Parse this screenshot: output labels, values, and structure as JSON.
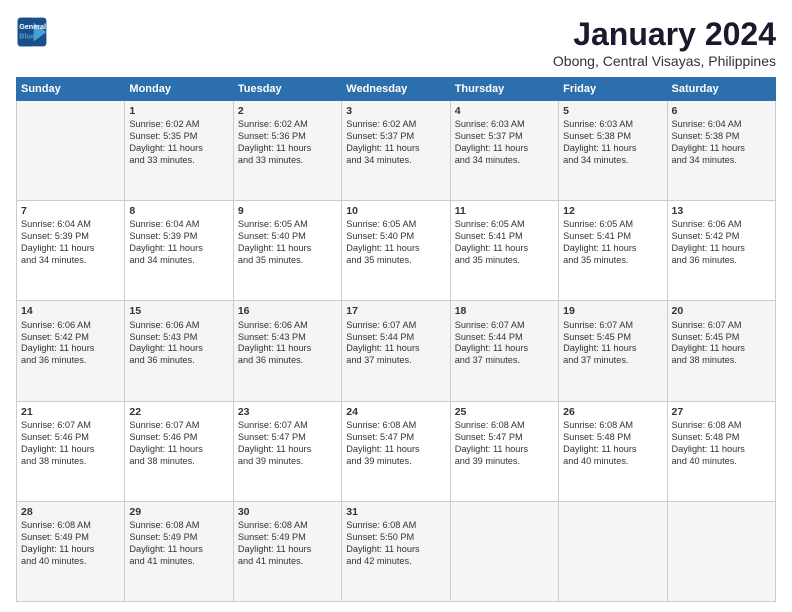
{
  "header": {
    "logo_line1": "General",
    "logo_line2": "Blue",
    "title": "January 2024",
    "subtitle": "Obong, Central Visayas, Philippines"
  },
  "days_of_week": [
    "Sunday",
    "Monday",
    "Tuesday",
    "Wednesday",
    "Thursday",
    "Friday",
    "Saturday"
  ],
  "weeks": [
    [
      {
        "day": "",
        "content": ""
      },
      {
        "day": "1",
        "content": "Sunrise: 6:02 AM\nSunset: 5:35 PM\nDaylight: 11 hours\nand 33 minutes."
      },
      {
        "day": "2",
        "content": "Sunrise: 6:02 AM\nSunset: 5:36 PM\nDaylight: 11 hours\nand 33 minutes."
      },
      {
        "day": "3",
        "content": "Sunrise: 6:02 AM\nSunset: 5:37 PM\nDaylight: 11 hours\nand 34 minutes."
      },
      {
        "day": "4",
        "content": "Sunrise: 6:03 AM\nSunset: 5:37 PM\nDaylight: 11 hours\nand 34 minutes."
      },
      {
        "day": "5",
        "content": "Sunrise: 6:03 AM\nSunset: 5:38 PM\nDaylight: 11 hours\nand 34 minutes."
      },
      {
        "day": "6",
        "content": "Sunrise: 6:04 AM\nSunset: 5:38 PM\nDaylight: 11 hours\nand 34 minutes."
      }
    ],
    [
      {
        "day": "7",
        "content": "Sunrise: 6:04 AM\nSunset: 5:39 PM\nDaylight: 11 hours\nand 34 minutes."
      },
      {
        "day": "8",
        "content": "Sunrise: 6:04 AM\nSunset: 5:39 PM\nDaylight: 11 hours\nand 34 minutes."
      },
      {
        "day": "9",
        "content": "Sunrise: 6:05 AM\nSunset: 5:40 PM\nDaylight: 11 hours\nand 35 minutes."
      },
      {
        "day": "10",
        "content": "Sunrise: 6:05 AM\nSunset: 5:40 PM\nDaylight: 11 hours\nand 35 minutes."
      },
      {
        "day": "11",
        "content": "Sunrise: 6:05 AM\nSunset: 5:41 PM\nDaylight: 11 hours\nand 35 minutes."
      },
      {
        "day": "12",
        "content": "Sunrise: 6:05 AM\nSunset: 5:41 PM\nDaylight: 11 hours\nand 35 minutes."
      },
      {
        "day": "13",
        "content": "Sunrise: 6:06 AM\nSunset: 5:42 PM\nDaylight: 11 hours\nand 36 minutes."
      }
    ],
    [
      {
        "day": "14",
        "content": "Sunrise: 6:06 AM\nSunset: 5:42 PM\nDaylight: 11 hours\nand 36 minutes."
      },
      {
        "day": "15",
        "content": "Sunrise: 6:06 AM\nSunset: 5:43 PM\nDaylight: 11 hours\nand 36 minutes."
      },
      {
        "day": "16",
        "content": "Sunrise: 6:06 AM\nSunset: 5:43 PM\nDaylight: 11 hours\nand 36 minutes."
      },
      {
        "day": "17",
        "content": "Sunrise: 6:07 AM\nSunset: 5:44 PM\nDaylight: 11 hours\nand 37 minutes."
      },
      {
        "day": "18",
        "content": "Sunrise: 6:07 AM\nSunset: 5:44 PM\nDaylight: 11 hours\nand 37 minutes."
      },
      {
        "day": "19",
        "content": "Sunrise: 6:07 AM\nSunset: 5:45 PM\nDaylight: 11 hours\nand 37 minutes."
      },
      {
        "day": "20",
        "content": "Sunrise: 6:07 AM\nSunset: 5:45 PM\nDaylight: 11 hours\nand 38 minutes."
      }
    ],
    [
      {
        "day": "21",
        "content": "Sunrise: 6:07 AM\nSunset: 5:46 PM\nDaylight: 11 hours\nand 38 minutes."
      },
      {
        "day": "22",
        "content": "Sunrise: 6:07 AM\nSunset: 5:46 PM\nDaylight: 11 hours\nand 38 minutes."
      },
      {
        "day": "23",
        "content": "Sunrise: 6:07 AM\nSunset: 5:47 PM\nDaylight: 11 hours\nand 39 minutes."
      },
      {
        "day": "24",
        "content": "Sunrise: 6:08 AM\nSunset: 5:47 PM\nDaylight: 11 hours\nand 39 minutes."
      },
      {
        "day": "25",
        "content": "Sunrise: 6:08 AM\nSunset: 5:47 PM\nDaylight: 11 hours\nand 39 minutes."
      },
      {
        "day": "26",
        "content": "Sunrise: 6:08 AM\nSunset: 5:48 PM\nDaylight: 11 hours\nand 40 minutes."
      },
      {
        "day": "27",
        "content": "Sunrise: 6:08 AM\nSunset: 5:48 PM\nDaylight: 11 hours\nand 40 minutes."
      }
    ],
    [
      {
        "day": "28",
        "content": "Sunrise: 6:08 AM\nSunset: 5:49 PM\nDaylight: 11 hours\nand 40 minutes."
      },
      {
        "day": "29",
        "content": "Sunrise: 6:08 AM\nSunset: 5:49 PM\nDaylight: 11 hours\nand 41 minutes."
      },
      {
        "day": "30",
        "content": "Sunrise: 6:08 AM\nSunset: 5:49 PM\nDaylight: 11 hours\nand 41 minutes."
      },
      {
        "day": "31",
        "content": "Sunrise: 6:08 AM\nSunset: 5:50 PM\nDaylight: 11 hours\nand 42 minutes."
      },
      {
        "day": "",
        "content": ""
      },
      {
        "day": "",
        "content": ""
      },
      {
        "day": "",
        "content": ""
      }
    ]
  ]
}
